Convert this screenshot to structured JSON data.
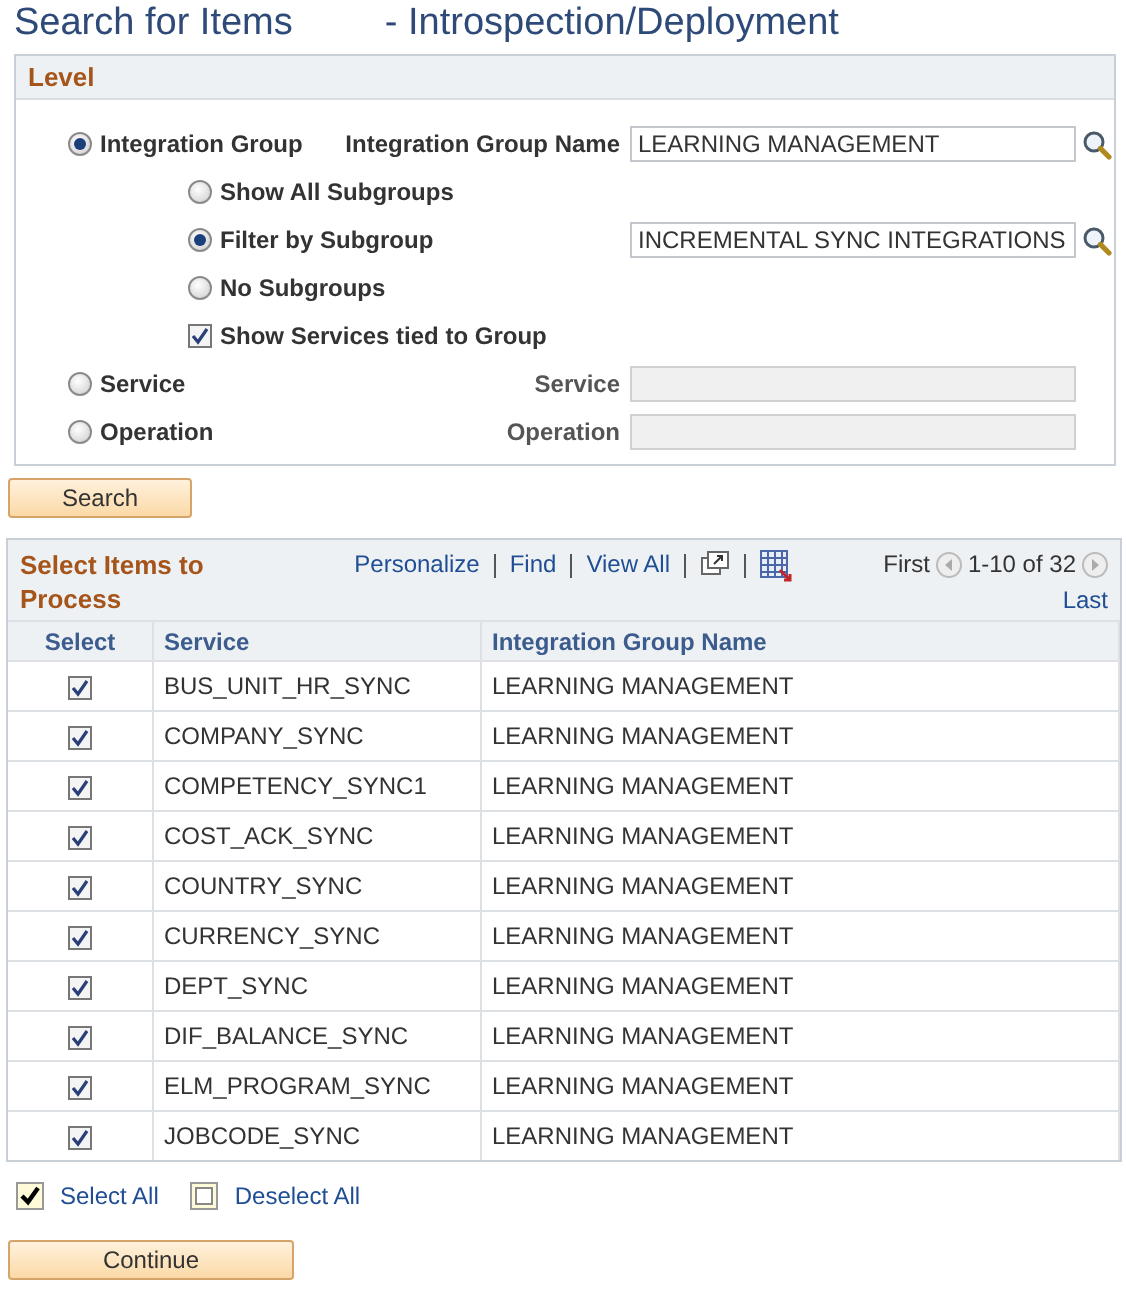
{
  "page_title": {
    "main": "Search for Items",
    "subtitle": "- Introspection/Deployment"
  },
  "level": {
    "title": "Level",
    "options": [
      {
        "kind": "radio",
        "label": "Integration Group",
        "selected": true,
        "field": {
          "label": "Integration Group Name",
          "value": "LEARNING MANAGEMENT",
          "disabled": false,
          "lookup": true
        },
        "children": [
          {
            "kind": "radio",
            "label": "Show All Subgroups",
            "selected": false
          },
          {
            "kind": "radio",
            "label": "Filter by Subgroup",
            "selected": true,
            "field": {
              "value": "INCREMENTAL SYNC INTEGRATIONS",
              "disabled": false,
              "lookup": true
            }
          },
          {
            "kind": "radio",
            "label": "No Subgroups",
            "selected": false
          },
          {
            "kind": "checkbox",
            "label": "Show Services tied to Group",
            "checked": true
          }
        ]
      },
      {
        "kind": "radio",
        "label": "Service",
        "selected": false,
        "field": {
          "label": "Service",
          "disabled": true,
          "lookup": false
        }
      },
      {
        "kind": "radio",
        "label": "Operation",
        "selected": false,
        "field": {
          "label": "Operation",
          "disabled": true,
          "lookup": false
        }
      }
    ]
  },
  "search_button": "Search",
  "grid": {
    "title": "Select Items to Process",
    "links": [
      "Personalize",
      "Find",
      "View All"
    ],
    "first": "First",
    "range": "1-10 of 32",
    "last": "Last",
    "columns": [
      "Select",
      "Service",
      "Integration Group Name"
    ],
    "rows": [
      {
        "checked": true,
        "service": "BUS_UNIT_HR_SYNC",
        "group": "LEARNING MANAGEMENT"
      },
      {
        "checked": true,
        "service": "COMPANY_SYNC",
        "group": "LEARNING MANAGEMENT"
      },
      {
        "checked": true,
        "service": "COMPETENCY_SYNC1",
        "group": "LEARNING MANAGEMENT"
      },
      {
        "checked": true,
        "service": "COST_ACK_SYNC",
        "group": "LEARNING MANAGEMENT"
      },
      {
        "checked": true,
        "service": "COUNTRY_SYNC",
        "group": "LEARNING MANAGEMENT"
      },
      {
        "checked": true,
        "service": "CURRENCY_SYNC",
        "group": "LEARNING MANAGEMENT"
      },
      {
        "checked": true,
        "service": "DEPT_SYNC",
        "group": "LEARNING MANAGEMENT"
      },
      {
        "checked": true,
        "service": "DIF_BALANCE_SYNC",
        "group": "LEARNING MANAGEMENT"
      },
      {
        "checked": true,
        "service": "ELM_PROGRAM_SYNC",
        "group": "LEARNING MANAGEMENT"
      },
      {
        "checked": true,
        "service": "JOBCODE_SYNC",
        "group": "LEARNING MANAGEMENT"
      }
    ]
  },
  "select_all": "Select All",
  "deselect_all": "Deselect All",
  "continue_button": "Continue"
}
